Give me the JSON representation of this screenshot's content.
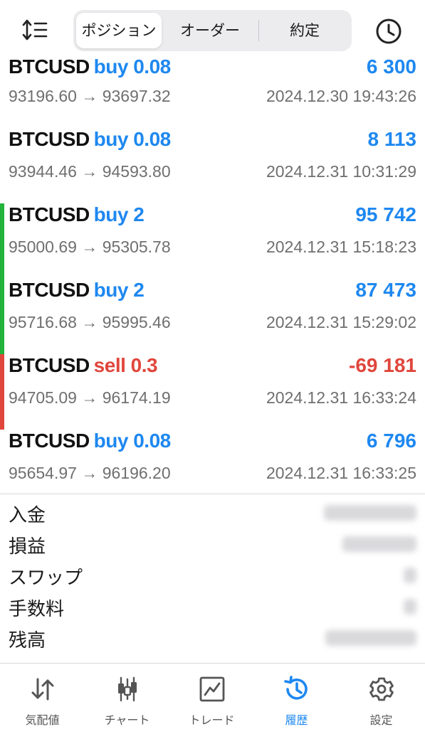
{
  "header": {
    "tabs": [
      {
        "label": "ポジション",
        "active": true
      },
      {
        "label": "オーダー",
        "active": false
      },
      {
        "label": "約定",
        "active": false
      }
    ],
    "sort_icon": "sort-icon",
    "history_icon": "clock-icon"
  },
  "colors": {
    "buy": "#1e88f0",
    "sell": "#e0463c",
    "buy_bar": "#22b33a",
    "sell_bar": "#e0463c"
  },
  "trades": [
    {
      "symbol": "BTCUSD",
      "direction": "buy 0.08",
      "profit": "6 300",
      "prices": "93196.60 → 93697.32",
      "time": "2024.12.30 19:43:26",
      "bar": "none"
    },
    {
      "symbol": "BTCUSD",
      "direction": "buy 0.08",
      "profit": "8 113",
      "prices": "93944.46 → 94593.80",
      "time": "2024.12.31 10:31:29",
      "bar": "none"
    },
    {
      "symbol": "BTCUSD",
      "direction": "buy 2",
      "profit": "95 742",
      "prices": "95000.69 → 95305.78",
      "time": "2024.12.31 15:18:23",
      "bar": "green"
    },
    {
      "symbol": "BTCUSD",
      "direction": "buy 2",
      "profit": "87 473",
      "prices": "95716.68 → 95995.46",
      "time": "2024.12.31 15:29:02",
      "bar": "green"
    },
    {
      "symbol": "BTCUSD",
      "direction": "sell 0.3",
      "profit": "-69 181",
      "prices": "94705.09 → 96174.19",
      "time": "2024.12.31 16:33:24",
      "bar": "red"
    },
    {
      "symbol": "BTCUSD",
      "direction": "buy 0.08",
      "profit": "6 796",
      "prices": "95654.97 → 96196.20",
      "time": "2024.12.31 16:33:25",
      "bar": "none"
    }
  ],
  "summary": [
    {
      "label": "入金"
    },
    {
      "label": "損益"
    },
    {
      "label": "スワップ"
    },
    {
      "label": "手数料"
    },
    {
      "label": "残高"
    }
  ],
  "nav": [
    {
      "label": "気配値",
      "icon": "quotes-arrows-icon",
      "active": false
    },
    {
      "label": "チャート",
      "icon": "candlestick-icon",
      "active": false
    },
    {
      "label": "トレード",
      "icon": "trade-chart-icon",
      "active": false
    },
    {
      "label": "履歴",
      "icon": "history-icon",
      "active": true
    },
    {
      "label": "設定",
      "icon": "gear-icon",
      "active": false
    }
  ]
}
